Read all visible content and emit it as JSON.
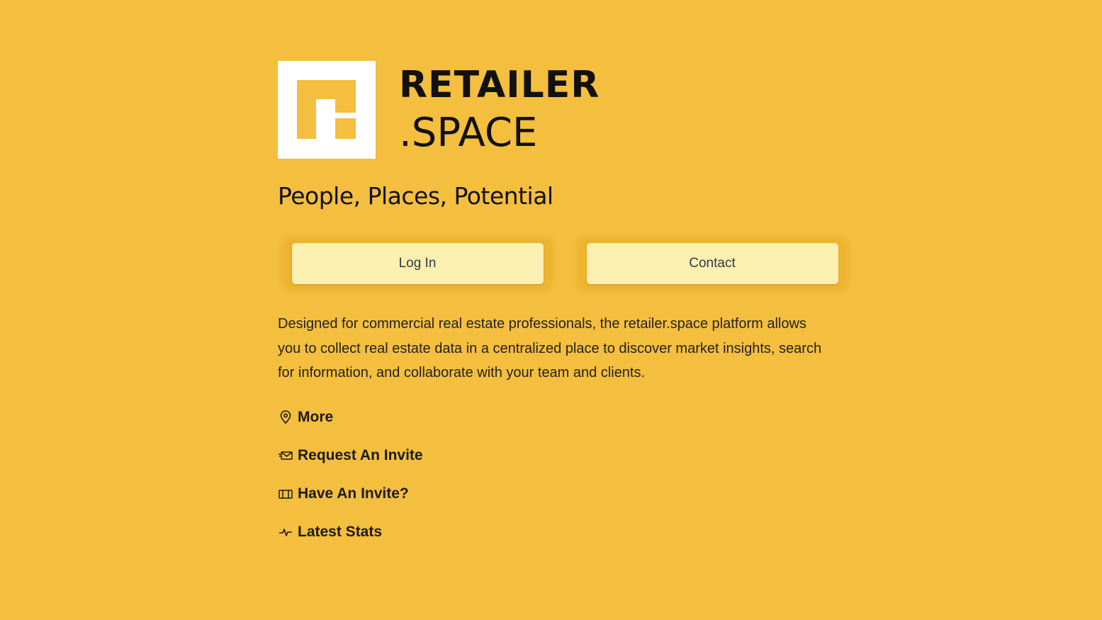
{
  "brand": {
    "line1": "RETAILER",
    "line2": ".SPACE",
    "tagline": "People, Places, Potential"
  },
  "buttons": {
    "login_label": "Log In",
    "contact_label": "Contact"
  },
  "description": "Designed for commercial real estate professionals, the retailer.space platform allows you to collect real estate data in a centralized place to discover market insights, search for information, and collaborate with your team and clients.",
  "links": [
    {
      "label": "More",
      "icon": "map-pin-icon"
    },
    {
      "label": "Request An Invite",
      "icon": "envelope-icon"
    },
    {
      "label": "Have An Invite?",
      "icon": "ticket-icon"
    },
    {
      "label": "Latest Stats",
      "icon": "pulse-icon"
    }
  ],
  "colors": {
    "background": "#F4BE3F",
    "button_frame": "#EDB42F",
    "button_fill": "#FCEFB2",
    "text": "#1b1b1b"
  }
}
